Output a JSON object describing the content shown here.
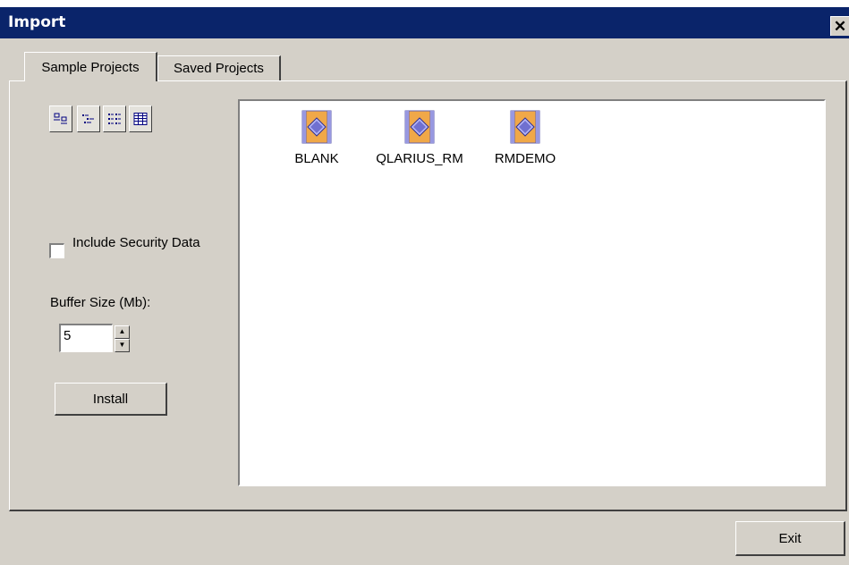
{
  "window": {
    "title": "Import",
    "close_glyph": "✕"
  },
  "tabs": [
    {
      "label": "Sample Projects",
      "active": true
    },
    {
      "label": "Saved Projects",
      "active": false
    }
  ],
  "view_buttons": [
    "large-icons-view-icon",
    "small-icons-view-icon",
    "list-view-icon",
    "details-view-icon"
  ],
  "projects": [
    {
      "label": "BLANK",
      "icon": "project-icon"
    },
    {
      "label": "QLARIUS_RM",
      "icon": "project-icon"
    },
    {
      "label": "RMDEMO",
      "icon": "project-icon"
    }
  ],
  "options": {
    "include_security_label": "Include Security Data",
    "include_security_checked": false,
    "buffer_label": "Buffer Size (Mb):",
    "buffer_value": "5",
    "install_label": "Install"
  },
  "footer": {
    "exit_label": "Exit"
  },
  "colors": {
    "titlebar": "#0a246a",
    "face": "#d4d0c8",
    "icon_fill": "#f0a848",
    "icon_frame": "#8c8cd8"
  }
}
